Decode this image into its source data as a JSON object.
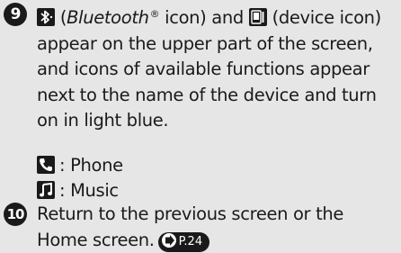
{
  "step9": {
    "number": "9",
    "bluetooth_name": "Bluetooth",
    "registered_mark": "®",
    "icon_word": " icon) and ",
    "device_icon_text": " (device icon) appear on the upper part of the screen, and icons of available functions appear next to the name of the device and turn on in light blue.",
    "open_paren": " (",
    "legend": [
      {
        "icon": "phone-icon",
        "label": ": Phone"
      },
      {
        "icon": "music-icon",
        "label": ": Music"
      }
    ]
  },
  "step10": {
    "number": "10",
    "text": "Return to the previous screen or the Home screen.",
    "xref_label": "P.24"
  },
  "colors": {
    "background": "#e6e6e6",
    "badge": "#1a1a1a",
    "text": "#1a1a1a"
  }
}
